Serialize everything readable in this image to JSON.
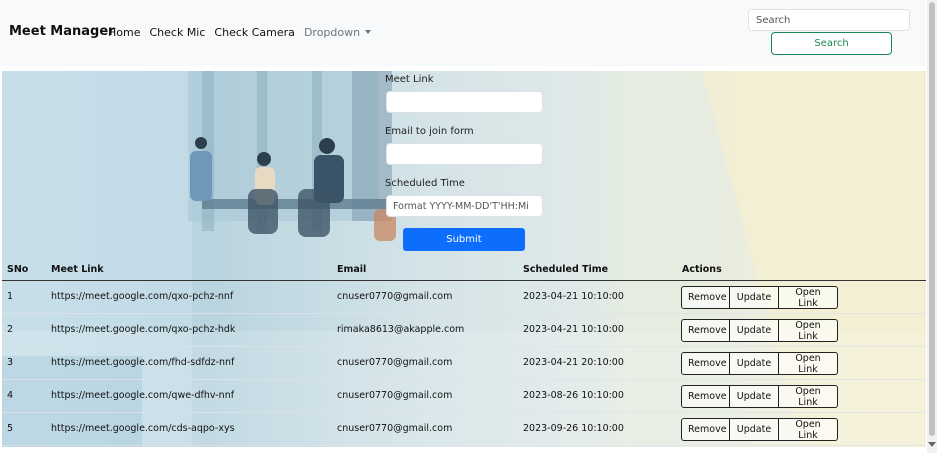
{
  "navbar": {
    "brand": "Meet Manager",
    "links": [
      "Home",
      "Check Mic",
      "Check Camera"
    ],
    "dropdown": "Dropdown",
    "search_placeholder": "Search",
    "search_button": "Search"
  },
  "form": {
    "meet_link_label": "Meet Link",
    "meet_link_value": "",
    "email_label": "Email to join form",
    "email_value": "",
    "time_label": "Scheduled Time",
    "time_placeholder": "Format YYYY-MM-DD'T'HH:Mi",
    "submit_label": "Submit"
  },
  "table": {
    "headers": [
      "SNo",
      "Meet Link",
      "Email",
      "Scheduled Time",
      "Actions"
    ],
    "rows": [
      {
        "sno": "1",
        "link": "https://meet.google.com/qxo-pchz-nnf",
        "email": "cnuser0770@gmail.com",
        "time": "2023-04-21 10:10:00"
      },
      {
        "sno": "2",
        "link": "https://meet.google.com/qxo-pchz-hdk",
        "email": "rimaka8613@akapple.com",
        "time": "2023-04-21 10:10:00"
      },
      {
        "sno": "3",
        "link": "https://meet.google.com/fhd-sdfdz-nnf",
        "email": "cnuser0770@gmail.com",
        "time": "2023-04-21 20:10:00"
      },
      {
        "sno": "4",
        "link": "https://meet.google.com/qwe-dfhv-nnf",
        "email": "cnuser0770@gmail.com",
        "time": "2023-08-26 10:10:00"
      },
      {
        "sno": "5",
        "link": "https://meet.google.com/cds-aqpo-xys",
        "email": "cnuser0770@gmail.com",
        "time": "2023-09-26 10:10:00"
      }
    ],
    "actions": {
      "remove": "Remove",
      "update": "Update",
      "open": "Open Link"
    }
  }
}
